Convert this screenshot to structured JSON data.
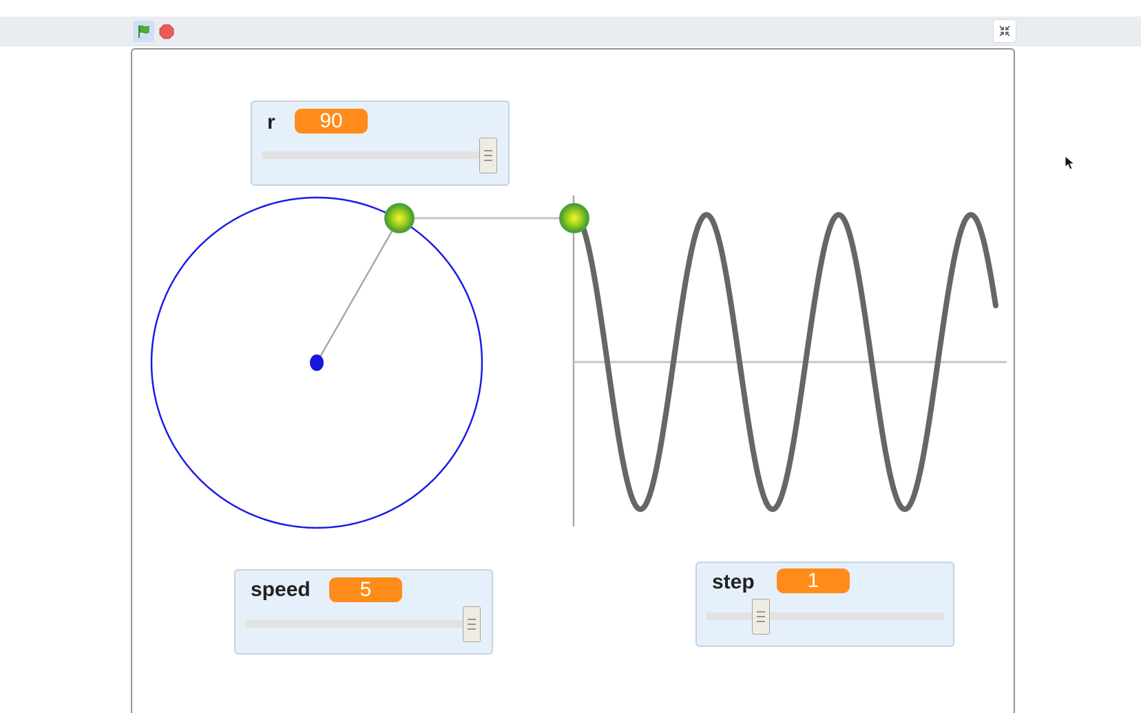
{
  "toolbar": {
    "green_flag_icon": "green-flag-icon",
    "stop_icon": "stop-sign-icon",
    "fullscreen_icon": "exit-fullscreen-icon"
  },
  "colors": {
    "accent": "#ff8c1a",
    "circle": "#1a1ae6",
    "wave": "#666666",
    "monitor_bg": "#e6f0fb"
  },
  "monitors": {
    "r": {
      "label": "r",
      "value": "90",
      "slider_fraction": 1.0
    },
    "speed": {
      "label": "speed",
      "value": "5",
      "slider_fraction": 1.0
    },
    "step": {
      "label": "step",
      "value": "1",
      "slider_fraction": 0.2
    }
  }
}
